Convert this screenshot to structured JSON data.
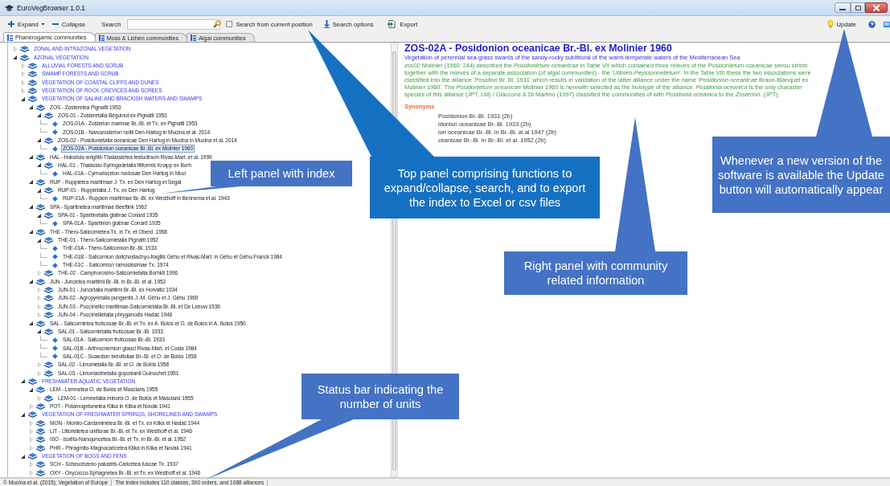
{
  "window": {
    "title": "EuroVegBrowser 1.0.1"
  },
  "toolbar": {
    "expand": "Expand",
    "collapse": "Collapse",
    "search_label": "Search",
    "search_from_current": {
      "label": "Search from current position",
      "checked": false
    },
    "search_options": "Search options",
    "export": "Export",
    "update": "Update"
  },
  "tabs": [
    {
      "label": "Phanerogamic communities",
      "selected": true
    },
    {
      "label": "Moss & Lichen communities",
      "selected": false
    },
    {
      "label": "Algal communities",
      "selected": false
    }
  ],
  "tree": [
    {
      "label": "ZONAL AND INTRAZONAL VEGETATION",
      "kind": "group",
      "expanded": false,
      "selected": false
    },
    {
      "label": "AZONAL VEGETATION",
      "kind": "group",
      "expanded": true,
      "selected": false,
      "children": [
        {
          "label": "ALLUVIAL FORESTS AND SCRUB",
          "kind": "group",
          "expanded": false,
          "selected": false
        },
        {
          "label": "SWAMP FORESTS AND SCRUB",
          "kind": "group",
          "expanded": false,
          "selected": false
        },
        {
          "label": "VEGETATION OF COASTAL CLIFFS AND DUNES",
          "kind": "group",
          "expanded": false,
          "selected": false
        },
        {
          "label": "VEGETATION OF ROCK CREVICES AND SCREES",
          "kind": "group",
          "expanded": false,
          "selected": false
        },
        {
          "label": "VEGETATION OF SALINE AND BRACKISH WATERS AND SWAMPS",
          "kind": "group",
          "expanded": true,
          "selected": false,
          "children": [
            {
              "label": "ZOS - Zosteretea Pignatti 1953",
              "kind": "unit",
              "expanded": true,
              "selected": false,
              "children": [
                {
                  "label": "ZOS-01 - Zosteretalia Béguinot ex Pignatti 1953",
                  "kind": "unit",
                  "expanded": true,
                  "selected": false,
                  "children": [
                    {
                      "label": "ZOS-01A - Zosterion marinae Br.-Bl. et Tx. ex Pignatti 1953",
                      "kind": "alliance",
                      "selected": false
                    },
                    {
                      "label": "ZOS-01B - Nanozosterion noltii Den Hartog in Mucina et al. 2014",
                      "kind": "alliance",
                      "selected": false
                    }
                  ]
                },
                {
                  "label": "ZOS-02 - Posidonietalia oceanicae Den Hartog in Mucina in Mucina et al. 2014",
                  "kind": "unit",
                  "expanded": true,
                  "selected": false,
                  "children": [
                    {
                      "label": "ZOS-02A - Posidonion oceanicae Br.-Bl. ex Molinier 1960",
                      "kind": "alliance",
                      "selected": true
                    }
                  ]
                }
              ]
            },
            {
              "label": "HAL - Halodulo wrightii-Thalassietea testudinum Rivas-Mart. et al. 1999",
              "kind": "unit",
              "expanded": true,
              "selected": false,
              "children": [
                {
                  "label": "HAL-01 - Thalassio-Syringodetalia filiformis Knapp ex Borh",
                  "kind": "unit",
                  "expanded": true,
                  "selected": false,
                  "children": [
                    {
                      "label": "HAL-01A - Cymodoceion nodosae Den Hartog in Muci",
                      "kind": "alliance",
                      "selected": false
                    }
                  ]
                }
              ]
            },
            {
              "label": "RUP - Ruppietea maritimae J. Tx. ex Den Hartog et Segal",
              "kind": "unit",
              "expanded": true,
              "selected": false,
              "children": [
                {
                  "label": "RUP-01 - Ruppietalia J. Tx. ex Den Hartog",
                  "kind": "unit",
                  "expanded": true,
                  "selected": false,
                  "children": [
                    {
                      "label": "RUP-01A - Ruppion maritimae Br.-Bl. ex Westhoff in Bennema et al. 1943",
                      "kind": "alliance",
                      "selected": false
                    }
                  ]
                }
              ]
            },
            {
              "label": "SPA - Spartinetea maritimae Beeftink 1962",
              "kind": "unit",
              "expanded": true,
              "selected": false,
              "children": [
                {
                  "label": "SPA-01 - Spartinetalia glabrae Conard 1935",
                  "kind": "unit",
                  "expanded": true,
                  "selected": false,
                  "children": [
                    {
                      "label": "SPA-01A - Spartinion glabrae Conard 1935",
                      "kind": "alliance",
                      "selected": false
                    }
                  ]
                }
              ]
            },
            {
              "label": "THE - Thero-Salicornietea Tx. in Tx. et Oberd. 1958",
              "kind": "unit",
              "expanded": true,
              "selected": false,
              "children": [
                {
                  "label": "THE-01 - Thero-Salicornietalia Pignatti 1952",
                  "kind": "unit",
                  "expanded": true,
                  "selected": false,
                  "children": [
                    {
                      "label": "THE-01A - Thero-Salicornion Br.-Bl. 1933",
                      "kind": "alliance",
                      "selected": false
                    },
                    {
                      "label": "THE-01B - Salicornion dolichostachyo-fragilis Géhu et Rivas-Mart. in Géhu et Géhu-Franck 1984",
                      "kind": "alliance",
                      "selected": false
                    },
                    {
                      "label": "THE-01C - Salicornion ramosissimae Tx. 1974",
                      "kind": "alliance",
                      "selected": false
                    }
                  ]
                },
                {
                  "label": "THE-02 - Camphorosmo-Salicornietalia Borhidi 1996",
                  "kind": "unit",
                  "expanded": false,
                  "selected": false
                }
              ]
            },
            {
              "label": "JUN - Juncetea maritimi Br.-Bl. in Br.-Bl. et al. 1952",
              "kind": "unit",
              "expanded": true,
              "selected": false,
              "children": [
                {
                  "label": "JUN-01 - Juncetalia maritimi Br.-Bl. ex Horvatić 1934",
                  "kind": "unit",
                  "expanded": false,
                  "selected": false
                },
                {
                  "label": "JUN-02 - Agropyretalia pungentis J.-M. Géhu et J. Géhu 1969",
                  "kind": "unit",
                  "expanded": false,
                  "selected": false
                },
                {
                  "label": "JUN-03 - Puccinellio maritimae-Salicornietalia Br.-Bl. et De Leeuw 1936",
                  "kind": "unit",
                  "expanded": false,
                  "selected": false
                },
                {
                  "label": "JUN-04 - Puccinellietalia phryganodis Hadač 1946",
                  "kind": "unit",
                  "expanded": false,
                  "selected": false
                }
              ]
            },
            {
              "label": "SAL - Salicornietea fruticosae Br.-Bl. et Tx. ex A. Bolòs et O. de Bolòs in A. Bolòs 1950",
              "kind": "unit",
              "expanded": true,
              "selected": false,
              "children": [
                {
                  "label": "SAL-01 - Salicornietalia fruticosae Br.-Bl. 1933",
                  "kind": "unit",
                  "expanded": true,
                  "selected": false,
                  "children": [
                    {
                      "label": "SAL-01A - Salicornion fruticosae Br.-Bl. 1933",
                      "kind": "alliance",
                      "selected": false
                    },
                    {
                      "label": "SAL-01B - Arthrocnemion glauci Rivas-Mart. et Costa 1984",
                      "kind": "alliance",
                      "selected": false
                    },
                    {
                      "label": "SAL-01C - Suaedion brevifoliae Br.-Bl. et O. de Bolòs 1958",
                      "kind": "alliance",
                      "selected": false
                    }
                  ]
                },
                {
                  "label": "SAL-02 - Limonietalia Br.-Bl. et O. de Bolòs 1958",
                  "kind": "unit",
                  "expanded": false,
                  "selected": false
                },
                {
                  "label": "SAL-03 - Limoniastrietalia guyonianii Guinochet 1951",
                  "kind": "unit",
                  "expanded": false,
                  "selected": false
                }
              ]
            }
          ]
        },
        {
          "label": "FRESHWATER AQUATIC VEGETATION",
          "kind": "group",
          "expanded": true,
          "selected": false,
          "children": [
            {
              "label": "LEM - Lemnetea O. de Bolòs et Masclans 1955",
              "kind": "unit",
              "expanded": true,
              "selected": false,
              "children": [
                {
                  "label": "LEM-01 - Lemnetalia minoris O. de Bolòs et Masclans 1955",
                  "kind": "unit",
                  "expanded": false,
                  "selected": false
                }
              ]
            },
            {
              "label": "POT - Potamogetonetea Klika in Klika et Novák 1941",
              "kind": "unit",
              "expanded": false,
              "selected": false
            }
          ]
        },
        {
          "label": "VEGETATION OF FRESHWATER SPRINGS, SHORELINES AND SWAMPS",
          "kind": "group",
          "expanded": true,
          "selected": false,
          "children": [
            {
              "label": "MON - Montio-Cardaminetea Br.-Bl. et Tx. ex Klika et Hadač 1944",
              "kind": "unit",
              "expanded": false,
              "selected": false
            },
            {
              "label": "LIT - Littorelletea uniflorae Br.-Bl. et Tx. ex Westhoff et al. 1946",
              "kind": "unit",
              "expanded": false,
              "selected": false
            },
            {
              "label": "ISO - Isoëto-Nanojuncetea Br.-Bl. et Tx. in Br.-Bl. et al. 1952",
              "kind": "unit",
              "expanded": false,
              "selected": false
            },
            {
              "label": "PHR - Phragmito-Magnocaricetea Klika in Klika et Novák 1941",
              "kind": "unit",
              "expanded": false,
              "selected": false
            }
          ]
        },
        {
          "label": "VEGETATION OF BOGS AND FENS",
          "kind": "group",
          "expanded": true,
          "selected": false,
          "children": [
            {
              "label": "SCH - Scheuchzerio palustris-Caricetea fuscae Tx. 1937",
              "kind": "unit",
              "expanded": false,
              "selected": false
            },
            {
              "label": "OXY - Oxycocco-Sphagnetea Br.-Bl. et Tx. ex Westhoff et al. 1946",
              "kind": "unit",
              "expanded": false,
              "selected": false
            }
          ]
        }
      ]
    }
  ],
  "detail": {
    "title": "ZOS-02A - Posidonion oceanicae Br.-Bl. ex Molinier 1960",
    "subtitle": "Vegetation of perennial sea-grass swards of the sandy-rocky sublittoral of the warm-temperate waters of the Mediterranean Sea",
    "description": "*zos02* Molinier (1960: 244) described the *Posidonietum oceanicae* in Table VII which contained three relevés of the Posidonietum oceanicae *sensu stricto* together with the relevés of a separate association (of algal communities) - the '*Udoteo-Peyssonnelietum*'. In the Table VIII these the two associations were classified into the alliance '*Posidion* Br. Bl. 1931' which results in validation of the latter alliance under the name '*Posidonion oceanicae* Braun-Blanquet ex Molinier 1960'. The *Posidonietum oceanicae* Molinier 1960 is herewith selected as the *holotype* of the alliance. *Posidonia oceanica* is the only character species of this alliance (JPT, LM) / Giaccone & Di Martino (1997) classified the communities of with *Posidonia oceanica* to the *Zosterion*. (JPT).",
    "synonyms_heading": "Synonyms",
    "synonyms": [
      "Posidonion Br.-Bl. 1931 (2b)",
      "idonion oceanicae Br.-Bl. 1933 (2b)",
      "ion oceanicae Br.-Bl. in Br.-Bl. al.al 1947 (2b)",
      "ceanicae Br.-Bl. In Br.-Bl. et al. 1952 (2b)"
    ]
  },
  "status_bar": [
    "© Mucina et al. (2015). Vegetation of Europe",
    "The index includes 110 classes, 300 orders, and 1088 alliances"
  ],
  "callouts": [
    {
      "text": "Left panel with index"
    },
    {
      "text": "Top panel comprising functions to expand/collapse, search, and to export the index to Excel or csv files"
    },
    {
      "text": "Whenever a new version of the software is available the Update button will automatically appear"
    },
    {
      "text": "Right panel with community related information"
    },
    {
      "text": "Status bar indicating the number of units"
    }
  ]
}
